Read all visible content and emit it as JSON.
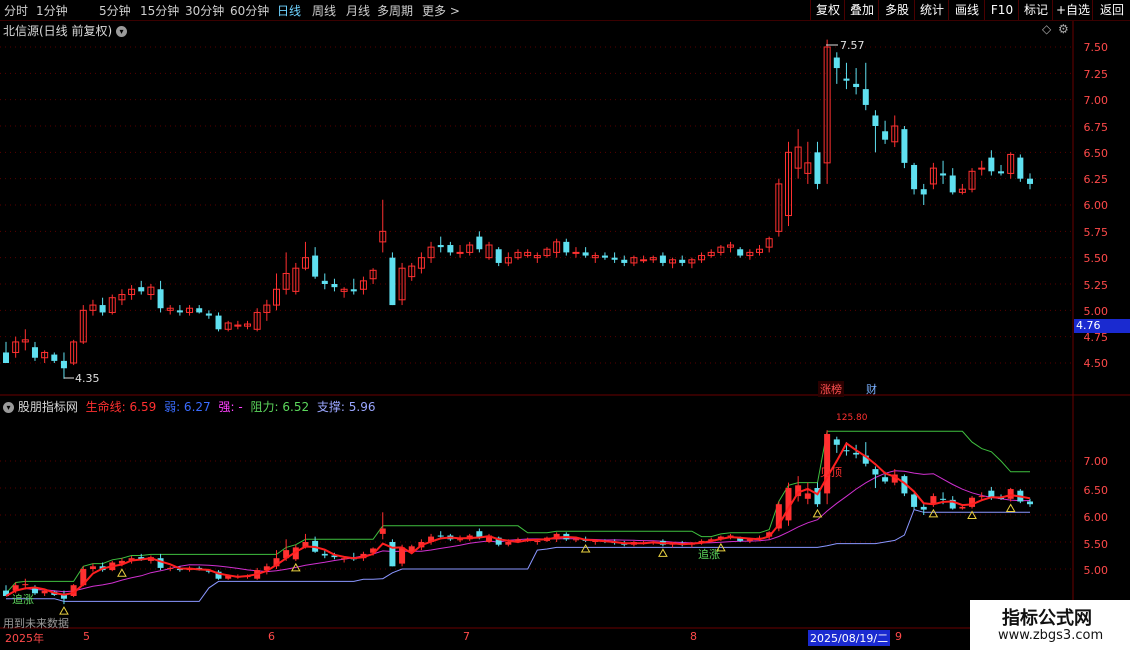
{
  "toolbar": {
    "tabs": [
      "分时",
      "1分钟",
      "5分钟",
      "15分钟",
      "30分钟",
      "60分钟",
      "日线",
      "周线",
      "月线",
      "多周期",
      "更多 >"
    ],
    "active_tab": "日线",
    "buttons": [
      "复权",
      "叠加",
      "多股",
      "统计",
      "画线",
      "F10",
      "标记",
      "+自选",
      "返回"
    ]
  },
  "chart_title": "北信源(日线 前复权)",
  "price_axis": [
    "7.50",
    "7.25",
    "7.00",
    "6.75",
    "6.50",
    "6.25",
    "6.00",
    "5.75",
    "5.50",
    "5.25",
    "5.00",
    "4.75",
    "4.50"
  ],
  "current_price": "4.76",
  "high_marker": "7.57",
  "low_marker": "4.35",
  "badges": {
    "zhangbang": "涨榜",
    "cai": "财"
  },
  "indicator": {
    "name": "股朋指标网",
    "life_label": "生命线: 6.59",
    "weak_label": "弱: 6.27",
    "strong_label": "强: -",
    "resist_label": "阻力: 6.52",
    "support_label": "支撑: 5.96",
    "axis": [
      "7.00",
      "6.50",
      "6.00",
      "5.50",
      "5.00"
    ],
    "signal_chase": "追涨",
    "signal_top": "见顶",
    "peak_label": "125.80"
  },
  "dates": {
    "year": "2025年",
    "m5": "5",
    "m6": "6",
    "m7": "7",
    "m8": "8",
    "cursor": "2025/08/19/二",
    "m9": "9",
    "future": "用到未来数据"
  },
  "watermark": {
    "title": "指标公式网",
    "url": "www.zbgs3.com"
  },
  "chart_data": {
    "type": "candlestick",
    "ylim": [
      4.35,
      7.6
    ],
    "ohlc": [
      [
        4.6,
        4.7,
        4.5,
        4.5
      ],
      [
        4.6,
        4.75,
        4.55,
        4.7
      ],
      [
        4.7,
        4.82,
        4.62,
        4.72
      ],
      [
        4.65,
        4.7,
        4.52,
        4.55
      ],
      [
        4.55,
        4.62,
        4.5,
        4.6
      ],
      [
        4.58,
        4.6,
        4.5,
        4.52
      ],
      [
        4.52,
        4.6,
        4.35,
        4.45
      ],
      [
        4.5,
        4.72,
        4.48,
        4.7
      ],
      [
        4.7,
        5.05,
        4.68,
        5.0
      ],
      [
        5.0,
        5.1,
        4.95,
        5.05
      ],
      [
        5.05,
        5.12,
        4.95,
        4.98
      ],
      [
        4.98,
        5.15,
        4.96,
        5.12
      ],
      [
        5.1,
        5.2,
        5.05,
        5.15
      ],
      [
        5.15,
        5.24,
        5.1,
        5.2
      ],
      [
        5.22,
        5.28,
        5.15,
        5.18
      ],
      [
        5.15,
        5.25,
        5.1,
        5.22
      ],
      [
        5.2,
        5.28,
        4.98,
        5.02
      ],
      [
        5.0,
        5.05,
        4.96,
        5.02
      ],
      [
        5.0,
        5.05,
        4.95,
        4.98
      ],
      [
        4.98,
        5.05,
        4.95,
        5.02
      ],
      [
        5.02,
        5.05,
        4.97,
        4.98
      ],
      [
        4.97,
        5.0,
        4.92,
        4.95
      ],
      [
        4.95,
        4.98,
        4.8,
        4.82
      ],
      [
        4.82,
        4.9,
        4.8,
        4.88
      ],
      [
        4.85,
        4.9,
        4.82,
        4.86
      ],
      [
        4.85,
        4.9,
        4.82,
        4.87
      ],
      [
        4.82,
        5.02,
        4.8,
        4.98
      ],
      [
        4.98,
        5.1,
        4.9,
        5.05
      ],
      [
        5.05,
        5.35,
        5.0,
        5.2
      ],
      [
        5.2,
        5.55,
        5.15,
        5.35
      ],
      [
        5.18,
        5.45,
        5.15,
        5.4
      ],
      [
        5.4,
        5.65,
        5.38,
        5.5
      ],
      [
        5.52,
        5.6,
        5.3,
        5.32
      ],
      [
        5.28,
        5.35,
        5.2,
        5.25
      ],
      [
        5.25,
        5.3,
        5.18,
        5.22
      ],
      [
        5.18,
        5.22,
        5.12,
        5.2
      ],
      [
        5.2,
        5.3,
        5.15,
        5.18
      ],
      [
        5.2,
        5.32,
        5.15,
        5.28
      ],
      [
        5.3,
        5.4,
        5.25,
        5.38
      ],
      [
        5.65,
        6.05,
        5.55,
        5.75
      ],
      [
        5.5,
        5.55,
        5.05,
        5.05
      ],
      [
        5.1,
        5.45,
        5.05,
        5.4
      ],
      [
        5.32,
        5.45,
        5.28,
        5.42
      ],
      [
        5.4,
        5.55,
        5.35,
        5.5
      ],
      [
        5.5,
        5.65,
        5.45,
        5.6
      ],
      [
        5.62,
        5.7,
        5.55,
        5.6
      ],
      [
        5.62,
        5.65,
        5.52,
        5.55
      ],
      [
        5.55,
        5.62,
        5.5,
        5.55
      ],
      [
        5.55,
        5.65,
        5.52,
        5.62
      ],
      [
        5.7,
        5.75,
        5.55,
        5.58
      ],
      [
        5.5,
        5.65,
        5.48,
        5.62
      ],
      [
        5.58,
        5.6,
        5.42,
        5.45
      ],
      [
        5.45,
        5.55,
        5.42,
        5.5
      ],
      [
        5.5,
        5.58,
        5.48,
        5.55
      ],
      [
        5.52,
        5.58,
        5.5,
        5.55
      ],
      [
        5.5,
        5.55,
        5.45,
        5.52
      ],
      [
        5.52,
        5.6,
        5.5,
        5.58
      ],
      [
        5.55,
        5.68,
        5.5,
        5.65
      ],
      [
        5.65,
        5.68,
        5.52,
        5.55
      ],
      [
        5.55,
        5.6,
        5.5,
        5.55
      ],
      [
        5.55,
        5.6,
        5.5,
        5.52
      ],
      [
        5.5,
        5.55,
        5.45,
        5.52
      ],
      [
        5.52,
        5.55,
        5.48,
        5.5
      ],
      [
        5.5,
        5.55,
        5.45,
        5.48
      ],
      [
        5.48,
        5.52,
        5.42,
        5.45
      ],
      [
        5.45,
        5.52,
        5.42,
        5.5
      ],
      [
        5.48,
        5.52,
        5.45,
        5.48
      ],
      [
        5.48,
        5.52,
        5.45,
        5.5
      ],
      [
        5.52,
        5.55,
        5.42,
        5.45
      ],
      [
        5.45,
        5.5,
        5.4,
        5.48
      ],
      [
        5.48,
        5.52,
        5.42,
        5.45
      ],
      [
        5.45,
        5.5,
        5.4,
        5.48
      ],
      [
        5.48,
        5.55,
        5.45,
        5.52
      ],
      [
        5.52,
        5.58,
        5.5,
        5.55
      ],
      [
        5.55,
        5.62,
        5.52,
        5.6
      ],
      [
        5.6,
        5.65,
        5.55,
        5.62
      ],
      [
        5.58,
        5.6,
        5.5,
        5.52
      ],
      [
        5.52,
        5.58,
        5.48,
        5.55
      ],
      [
        5.55,
        5.62,
        5.52,
        5.58
      ],
      [
        5.6,
        5.7,
        5.55,
        5.68
      ],
      [
        5.75,
        6.25,
        5.7,
        6.2
      ],
      [
        5.9,
        6.6,
        5.8,
        6.5
      ],
      [
        6.35,
        6.72,
        6.25,
        6.55
      ],
      [
        6.3,
        6.6,
        6.2,
        6.4
      ],
      [
        6.5,
        6.6,
        6.15,
        6.2
      ],
      [
        6.4,
        7.57,
        6.2,
        7.5
      ],
      [
        7.4,
        7.45,
        7.15,
        7.3
      ],
      [
        7.2,
        7.35,
        7.1,
        7.18
      ],
      [
        7.15,
        7.3,
        7.05,
        7.12
      ],
      [
        7.1,
        7.35,
        6.9,
        6.95
      ],
      [
        6.85,
        6.9,
        6.5,
        6.75
      ],
      [
        6.7,
        6.8,
        6.58,
        6.62
      ],
      [
        6.6,
        6.85,
        6.55,
        6.75
      ],
      [
        6.72,
        6.75,
        6.35,
        6.4
      ],
      [
        6.38,
        6.4,
        6.1,
        6.15
      ],
      [
        6.15,
        6.2,
        6.0,
        6.1
      ],
      [
        6.2,
        6.4,
        6.15,
        6.35
      ],
      [
        6.3,
        6.42,
        6.2,
        6.28
      ],
      [
        6.28,
        6.35,
        6.1,
        6.12
      ],
      [
        6.12,
        6.2,
        6.1,
        6.15
      ],
      [
        6.15,
        6.35,
        6.12,
        6.32
      ],
      [
        6.35,
        6.42,
        6.28,
        6.35
      ],
      [
        6.45,
        6.52,
        6.28,
        6.32
      ],
      [
        6.32,
        6.38,
        6.28,
        6.3
      ],
      [
        6.3,
        6.5,
        6.25,
        6.48
      ],
      [
        6.45,
        6.48,
        6.22,
        6.25
      ],
      [
        6.25,
        6.3,
        6.15,
        6.2
      ]
    ]
  }
}
